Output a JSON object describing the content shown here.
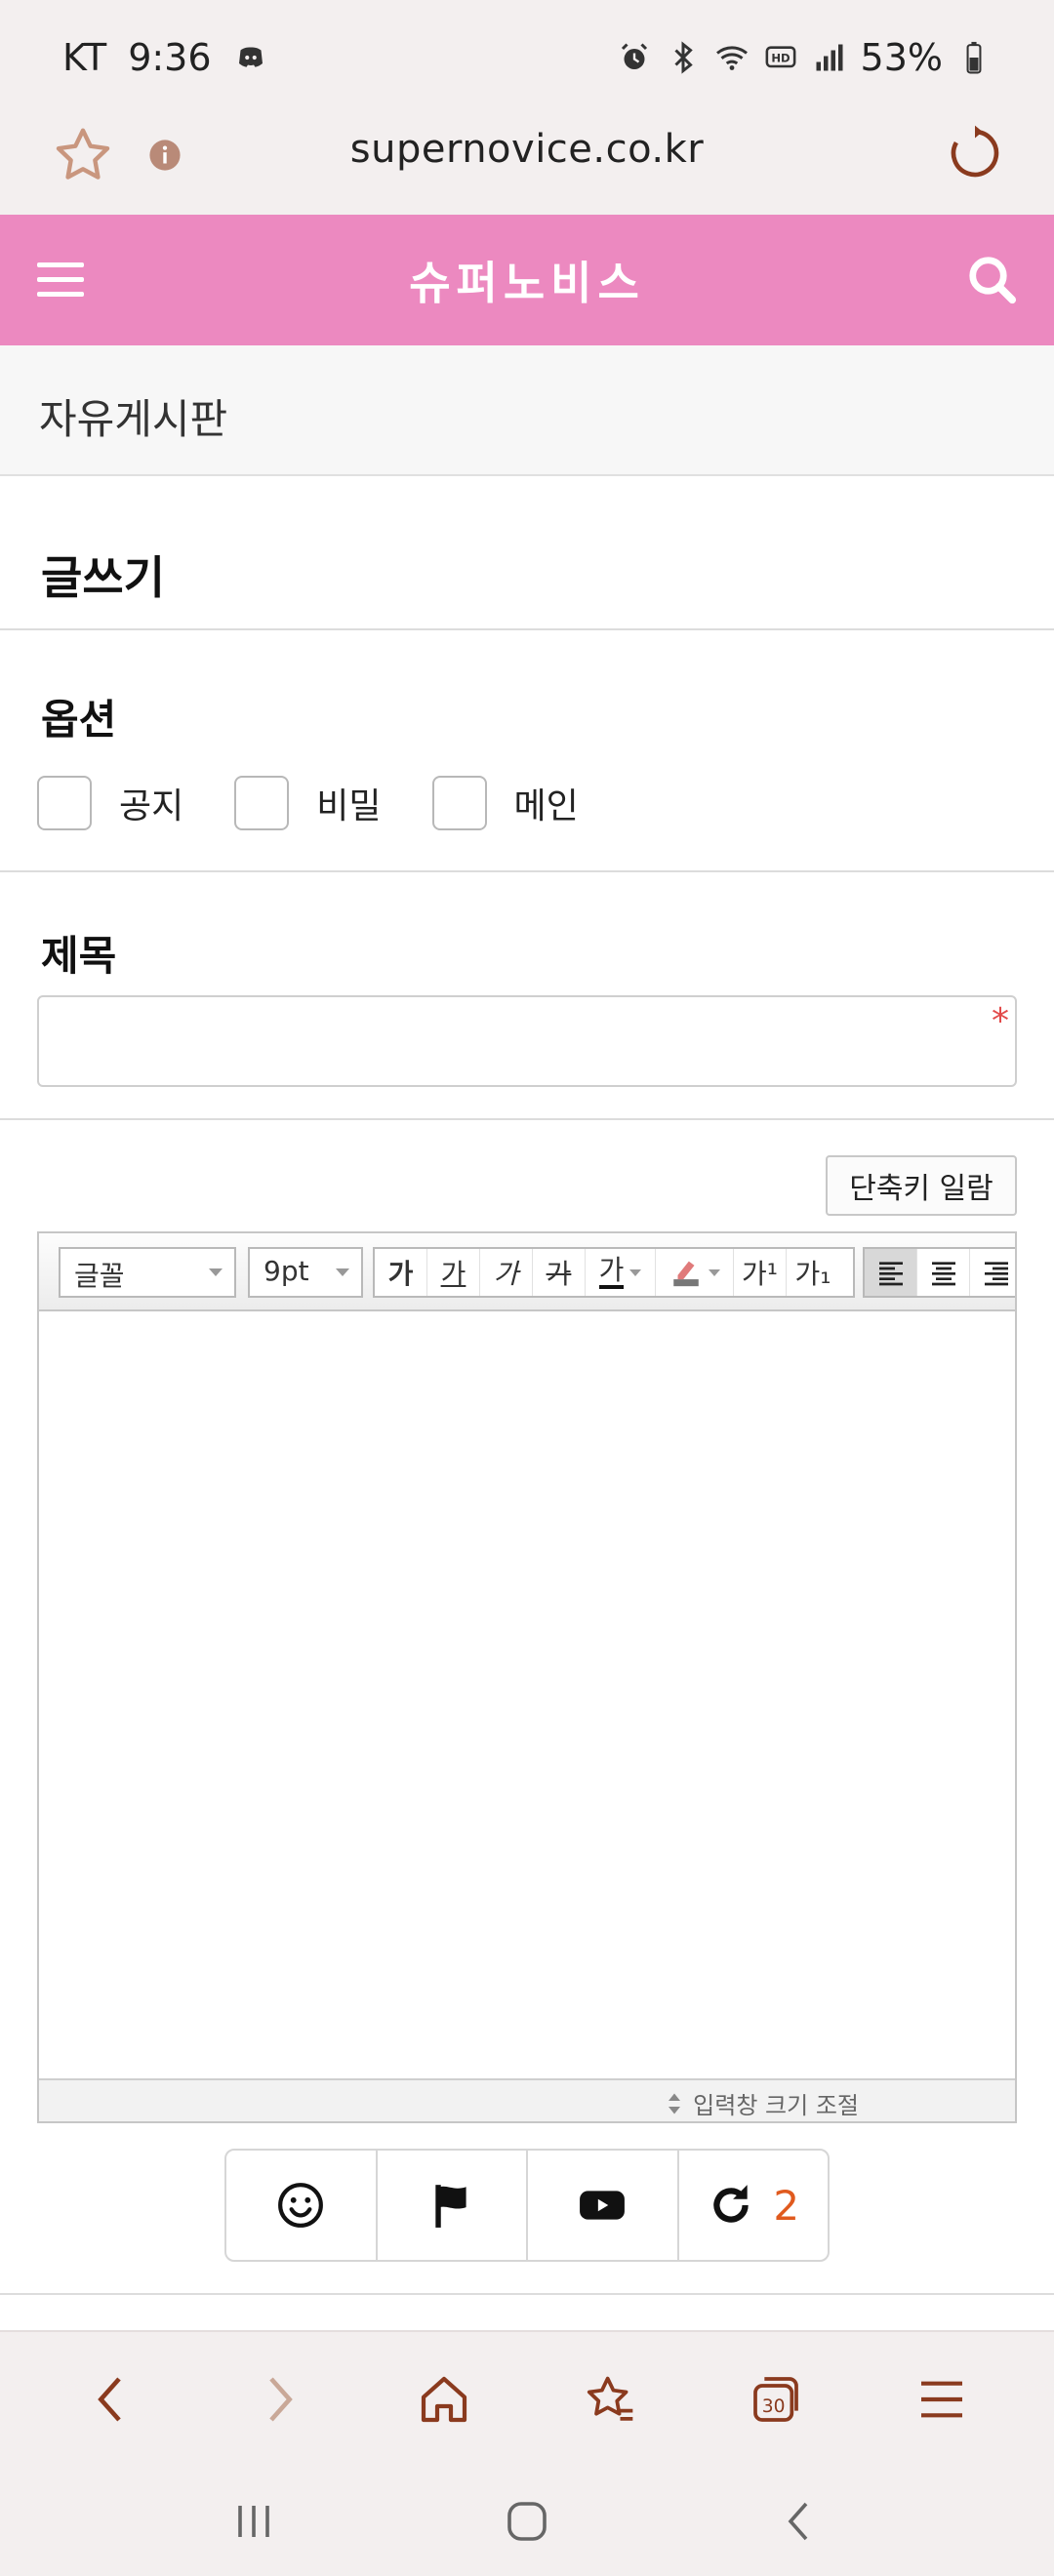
{
  "status_bar": {
    "carrier": "KT",
    "time": "9:36",
    "battery": "53%"
  },
  "browser": {
    "url": "supernovice.co.kr"
  },
  "site": {
    "title": "슈퍼노비스"
  },
  "board": {
    "name": "자유게시판"
  },
  "page": {
    "heading": "글쓰기"
  },
  "options": {
    "label": "옵션",
    "items": [
      {
        "label": "공지",
        "checked": false
      },
      {
        "label": "비밀",
        "checked": false
      },
      {
        "label": "메인",
        "checked": false
      }
    ]
  },
  "subject": {
    "label": "제목",
    "value": "",
    "required_mark": "*"
  },
  "editor": {
    "shortcut_button": "단축키 일람",
    "font_select": "글꼴",
    "size_select": "9pt",
    "format_buttons": [
      "가",
      "가",
      "가",
      "가",
      "가"
    ],
    "superscript": "가¹",
    "subscript": "가₁",
    "resize_label": "입력창 크기 조절"
  },
  "attachments": {
    "count": "2"
  },
  "colors": {
    "header_pink": "#ec89c0",
    "nav_icon": "#8a3a1e",
    "count_orange": "#e05a1e"
  }
}
